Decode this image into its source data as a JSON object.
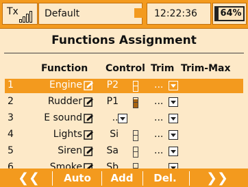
{
  "status_bar": {
    "tx_label": "Tx",
    "model_name": "Default",
    "time": "12:22:36",
    "battery_percent": "64%",
    "tx_signal_bars": 4
  },
  "screen": {
    "title": "Functions Assignment",
    "columns": {
      "function": "Function",
      "control": "Control",
      "trim": "Trim",
      "trim_max": "Trim-Max"
    }
  },
  "rows": [
    {
      "num": "1",
      "function": "Engine",
      "control": "P2",
      "trim": "...",
      "trim_level": 0.35,
      "selected": true
    },
    {
      "num": "2",
      "function": "Rudder",
      "control": "P1",
      "trim": "...",
      "trim_level": 0.85,
      "selected": false
    },
    {
      "num": "3",
      "function": "E sound",
      "control": "...",
      "trim": "...",
      "selected": false
    },
    {
      "num": "4",
      "function": "Lights",
      "control": "Si",
      "trim": "...",
      "trim_level": 0.0,
      "selected": false
    },
    {
      "num": "5",
      "function": "Siren",
      "control": "Sa",
      "trim": "...",
      "trim_level": 0.0,
      "selected": false
    },
    {
      "num": "6",
      "function": "Smoke",
      "control": "Sb",
      "trim": "...",
      "trim_level": 0.0,
      "selected": false
    }
  ],
  "bottom_bar": {
    "prev": "❮❮",
    "auto": "Auto",
    "add": "Add",
    "del": "Del.",
    "next": "❯❯"
  },
  "colors": {
    "accent": "#f39a1e",
    "panel": "#fde9c8"
  }
}
